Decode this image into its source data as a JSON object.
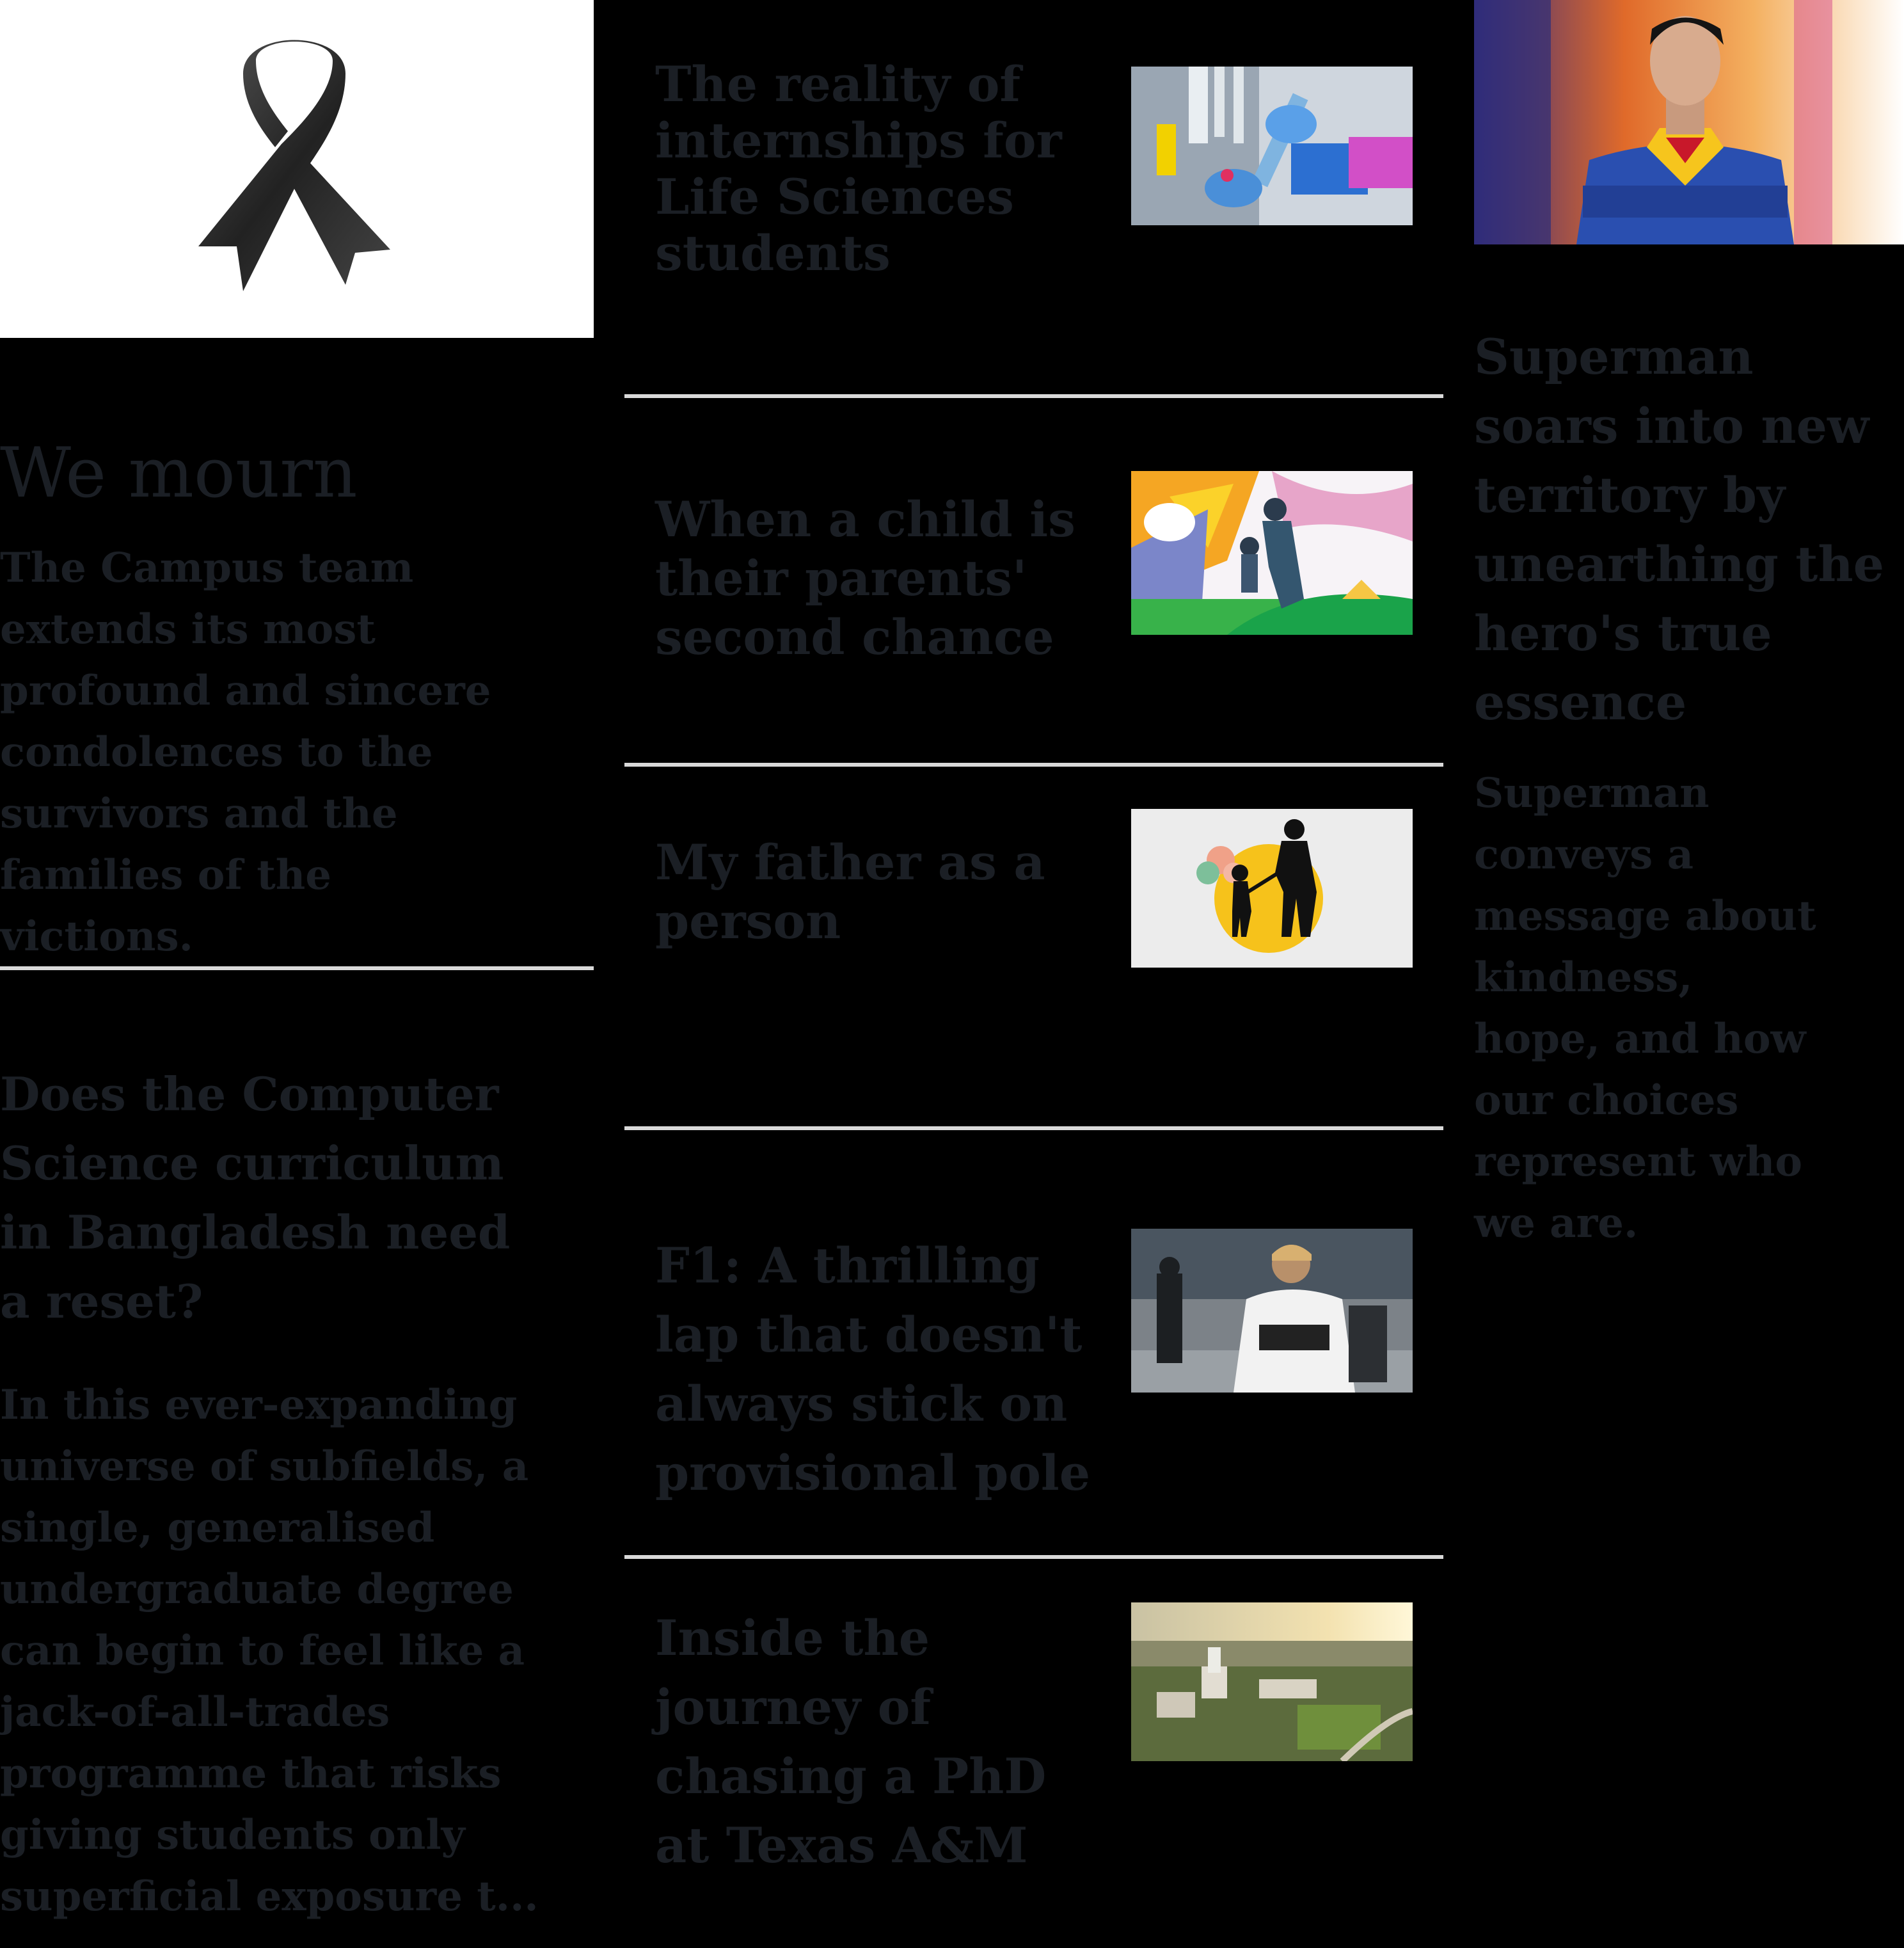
{
  "left": {
    "lead": {
      "title": "We mourn",
      "summary": "The Campus team extends its most profound and sincere condolences to the survivors and the families of the victions."
    },
    "second": {
      "title": "Does the Computer Science curriculum in Bangladesh need a reset?",
      "summary": "In this ever-expanding universe of subfields, a single, generalised undergraduate degree can begin to feel like a jack-of-all-trades programme that risks giving students only superficial exposure t..."
    }
  },
  "middle": {
    "stories": [
      {
        "title": "The reality of internships for Life Sciences students"
      },
      {
        "title": "When a child is their parents' second chance"
      },
      {
        "title": "My father as a person"
      },
      {
        "title": "F1: A thrilling lap that doesn't always stick on provisional pole"
      },
      {
        "title": "Inside the journey of chasing a PhD at Texas A&M"
      }
    ]
  },
  "right": {
    "title": "Superman soars into new territory by unearthing the hero's true essence",
    "summary": "Superman conveys a message about kindness, hope, and how our choices represent who we are."
  }
}
